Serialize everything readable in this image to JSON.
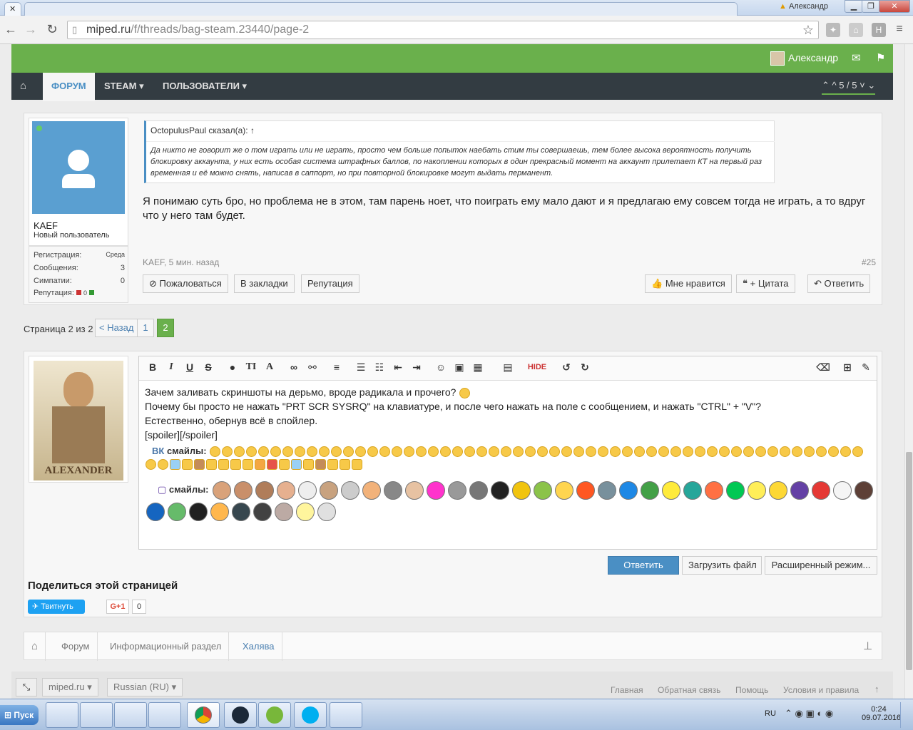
{
  "browser": {
    "tab_title": "miped.ru/f/threads/bag-steam.23440/page-2",
    "user_badge": "Александр",
    "url_prefix": "miped.ru",
    "url_rest": "/f/threads/bag-steam.23440/page-2",
    "win_min": "▁",
    "win_max": "❐",
    "win_close": "✕"
  },
  "site": {
    "username": "Александр",
    "nav": {
      "home_icon": "home-icon",
      "forum": "ФОРУМ",
      "steam": "STEAM",
      "users": "ПОЛЬЗОВАТЕЛИ",
      "pager": "5 / 5"
    }
  },
  "post": {
    "author": "KAEF",
    "role": "Новый пользователь",
    "stats": [
      {
        "label": "Регистрация:",
        "value": "Среда"
      },
      {
        "label": "Сообщения:",
        "value": "3"
      },
      {
        "label": "Симпатии:",
        "value": "0"
      },
      {
        "label": "Репутация:",
        "value": "0"
      }
    ],
    "quote_author": "OctopulusPaul сказал(а): ↑",
    "quote_text": "Да никто не говорит же о том играть или не играть, просто чем больше попыток наебать стим ты совершаешь, тем более высока вероятность получить блокировку аккаунта, у них есть особая система штрафных баллов, по накоплении которых в один прекрасный момент на аккаунт прилетает КТ на первый раз временная и её можно снять, написав в саппорт, но при повторной блокировке могут выдать перманент.",
    "body": "Я понимаю суть бро, но проблема не в этом, там парень ноет, что поиграть ему мало дают и я предлагаю ему совсем тогда не играть, а то вдруг что у него там будет.",
    "meta": "KAEF, 5 мин. назад",
    "number": "#25",
    "actions": {
      "report": "Пожаловаться",
      "bookmark": "В закладки",
      "reputation": "Репутация",
      "like": "Мне нравится",
      "quote": "+ Цитата",
      "reply": "Ответить"
    }
  },
  "pagination": {
    "label": "Страница 2 из 2",
    "prev": "< Назад",
    "pages": [
      "1",
      "2"
    ]
  },
  "editor": {
    "avatar_caption": "ALEXANDER",
    "lines": [
      "Зачем заливать скриншоты на дерьмо, вроде радикала и прочего?",
      "Почему бы просто не нажать \"PRT SCR SYSRQ\" на клавиатуре, и после чего нажать на поле с сообщением, и нажать \"CTRL\" + \"V\"?",
      "Естественно, обернув всё в спойлер.",
      "[spoiler][/spoiler]"
    ],
    "smiles_label": "смайлы:",
    "twitch_label": "смайлы:",
    "hide_label": "HIDE",
    "submit": "Ответить",
    "upload": "Загрузить файл",
    "advanced": "Расширенный режим..."
  },
  "share": {
    "title": "Поделиться этой страницей",
    "tweet": "Твитнуть",
    "gplus": "G+1",
    "gcount": "0"
  },
  "breadcrumb": [
    "Форум",
    "Информационный раздел",
    "Халява"
  ],
  "footer": {
    "site": "miped.ru",
    "lang": "Russian (RU)",
    "links": [
      "Главная",
      "Обратная связь",
      "Помощь",
      "Условия и правила"
    ]
  },
  "taskbar": {
    "start": "Пуск",
    "lang": "RU",
    "time": "0:24",
    "date": "09.07.2016"
  },
  "colors": {
    "green": "#6ab04c",
    "nav": "#333c42",
    "link": "#4a7fb0",
    "accent": "#4a8fc4"
  }
}
